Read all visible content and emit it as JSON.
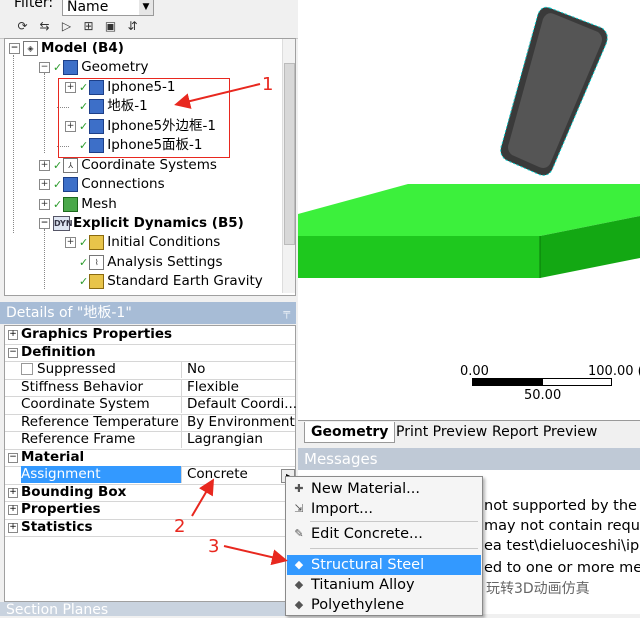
{
  "filter": {
    "label": "Filter:",
    "value": "Name"
  },
  "tree": {
    "items": [
      {
        "label": "Model (B4)",
        "bold": true,
        "icon": "model-icon"
      },
      {
        "label": "Geometry",
        "icon": "geometry-icon"
      },
      {
        "label": "Iphone5-1",
        "icon": "body-icon"
      },
      {
        "label": "地板-1",
        "icon": "body-icon"
      },
      {
        "label": "Iphone5外边框-1",
        "icon": "body-icon"
      },
      {
        "label": "Iphone5面板-1",
        "icon": "body-icon"
      },
      {
        "label": "Coordinate Systems",
        "icon": "coordinate-systems-icon"
      },
      {
        "label": "Connections",
        "icon": "connections-icon"
      },
      {
        "label": "Mesh",
        "icon": "mesh-icon"
      },
      {
        "label": "Explicit Dynamics (B5)",
        "bold": true,
        "icon": "dyn-icon"
      },
      {
        "label": "Initial Conditions",
        "icon": "initial-conditions-icon"
      },
      {
        "label": "Analysis Settings",
        "icon": "analysis-settings-icon"
      },
      {
        "label": "Standard Earth Gravity",
        "icon": "gravity-icon"
      }
    ]
  },
  "details": {
    "title": "Details of \"地板-1\"",
    "rows": [
      {
        "type": "header",
        "label": "Graphics Properties"
      },
      {
        "type": "header",
        "label": "Definition"
      },
      {
        "type": "row",
        "key": "Suppressed",
        "value": "No"
      },
      {
        "type": "row",
        "key": "Stiffness Behavior",
        "value": "Flexible"
      },
      {
        "type": "row",
        "key": "Coordinate System",
        "value": "Default Coordi..."
      },
      {
        "type": "row",
        "key": "Reference Temperature",
        "value": "By Environment"
      },
      {
        "type": "row",
        "key": "Reference Frame",
        "value": "Lagrangian"
      },
      {
        "type": "header",
        "label": "Material"
      },
      {
        "type": "row",
        "key": "Assignment",
        "value": "Concrete",
        "selected": true
      },
      {
        "type": "header",
        "label": "Bounding Box"
      },
      {
        "type": "header",
        "label": "Properties"
      },
      {
        "type": "header",
        "label": "Statistics"
      }
    ]
  },
  "section_planes": "Section Planes",
  "viewport": {
    "scale_left": "0.00",
    "scale_right": "100.00 (r",
    "scale_mid": "50.00",
    "colors": {
      "plate": "#22dd22",
      "phone": "#3c3c3c"
    }
  },
  "tabs": [
    "Geometry",
    "Print Preview",
    "Report Preview"
  ],
  "messages": {
    "title": "Messages",
    "lines": [
      "not supported by the",
      "may not contain reque",
      "ea test\\dieluoceshi\\iph",
      "ed to one or more me"
    ]
  },
  "context_menu": {
    "items": [
      {
        "label": "New Material...",
        "icon": "new-material-icon"
      },
      {
        "label": "Import...",
        "icon": "import-icon"
      },
      {
        "label": "Edit Concrete...",
        "icon": "edit-material-icon"
      },
      {
        "label": "Structural Steel",
        "icon": "material-icon",
        "highlighted": true
      },
      {
        "label": "Titanium Alloy",
        "icon": "material-icon"
      },
      {
        "label": "Polyethylene",
        "icon": "material-icon"
      }
    ]
  },
  "annotations": {
    "n1": "1",
    "n2": "2",
    "n3": "3"
  },
  "watermark": "玩转3D动画仿真"
}
